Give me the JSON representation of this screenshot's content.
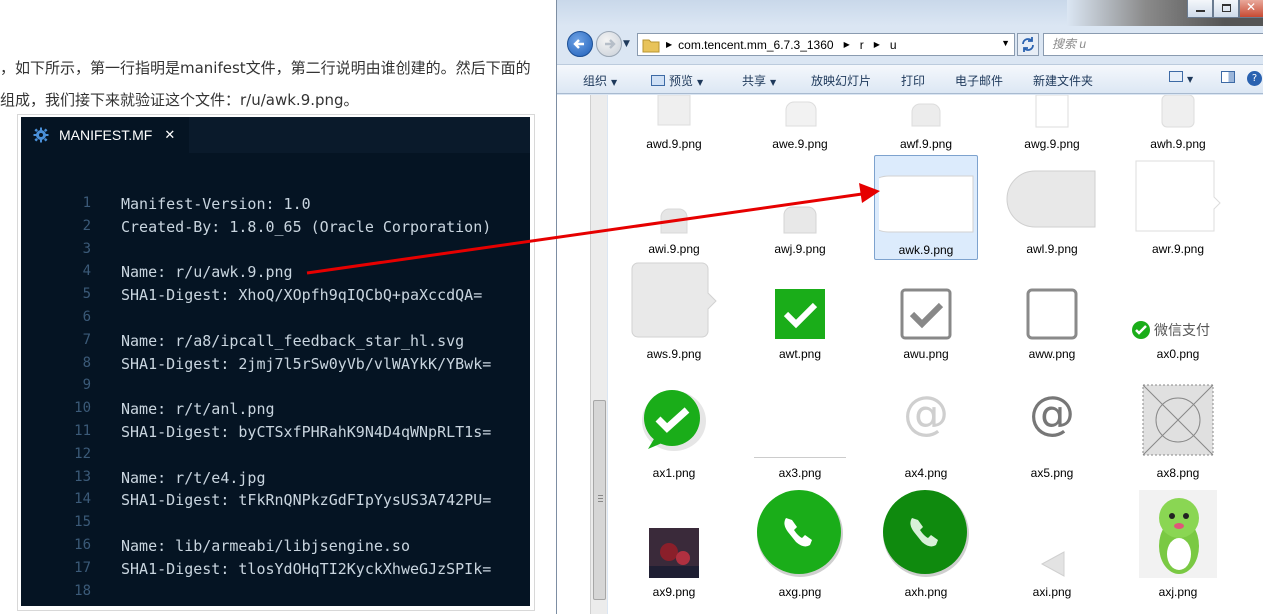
{
  "article": {
    "line1": "，如下所示，第一行指明是manifest文件，第二行说明由谁创建的。然后下面的",
    "line2": "组成，我们接下来就验证这个文件：r/u/awk.9.png。"
  },
  "editor": {
    "tab_label": "MANIFEST.MF",
    "close_glyph": "✕",
    "lines": [
      {
        "n": "1",
        "t": "Manifest-Version: 1.0"
      },
      {
        "n": "2",
        "t": "Created-By: 1.8.0_65 (Oracle Corporation)"
      },
      {
        "n": "3",
        "t": ""
      },
      {
        "n": "4",
        "t": "Name: r/u/awk.9.png"
      },
      {
        "n": "5",
        "t": "SHA1-Digest: XhoQ/XOpfh9qIQCbQ+paXccdQA="
      },
      {
        "n": "6",
        "t": ""
      },
      {
        "n": "7",
        "t": "Name: r/a8/ipcall_feedback_star_hl.svg"
      },
      {
        "n": "8",
        "t": "SHA1-Digest: 2jmj7l5rSw0yVb/vlWAYkK/YBwk="
      },
      {
        "n": "9",
        "t": ""
      },
      {
        "n": "10",
        "t": "Name: r/t/anl.png"
      },
      {
        "n": "11",
        "t": "SHA1-Digest: byCTSxfPHRahK9N4D4qWNpRLT1s="
      },
      {
        "n": "12",
        "t": ""
      },
      {
        "n": "13",
        "t": "Name: r/t/e4.jpg"
      },
      {
        "n": "14",
        "t": "SHA1-Digest: tFkRnQNPkzGdFIpYysUS3A742PU="
      },
      {
        "n": "15",
        "t": ""
      },
      {
        "n": "16",
        "t": "Name: lib/armeabi/libjsengine.so"
      },
      {
        "n": "17",
        "t": "SHA1-Digest: tlosYdOHqTI2KyckXhweGJzSPIk="
      },
      {
        "n": "18",
        "t": ""
      }
    ]
  },
  "explorer": {
    "path": [
      "com.tencent.mm_6.7.3_1360",
      "r",
      "u"
    ],
    "search_placeholder": "搜索 u",
    "toolbar": [
      "组织",
      "预览",
      "共享",
      "放映幻灯片",
      "打印",
      "电子邮件",
      "新建文件夹"
    ],
    "files": [
      "awd.9.png",
      "awe.9.png",
      "awf.9.png",
      "awg.9.png",
      "awh.9.png",
      "awi.9.png",
      "awj.9.png",
      "awk.9.png",
      "awl.9.png",
      "awr.9.png",
      "aws.9.png",
      "awt.png",
      "awu.png",
      "aww.png",
      "ax0.png",
      "ax1.png",
      "ax3.png",
      "ax4.png",
      "ax5.png",
      "ax8.png",
      "ax9.png",
      "axg.png",
      "axh.png",
      "axi.png",
      "axj.png"
    ],
    "wechat_pay_label": "微信支付",
    "selected_file": "awk.9.png"
  },
  "colors": {
    "editor_bg": "#051423",
    "selection": "#dcebfc",
    "arrow": "#e60000",
    "wechat_green": "#1aad19"
  }
}
